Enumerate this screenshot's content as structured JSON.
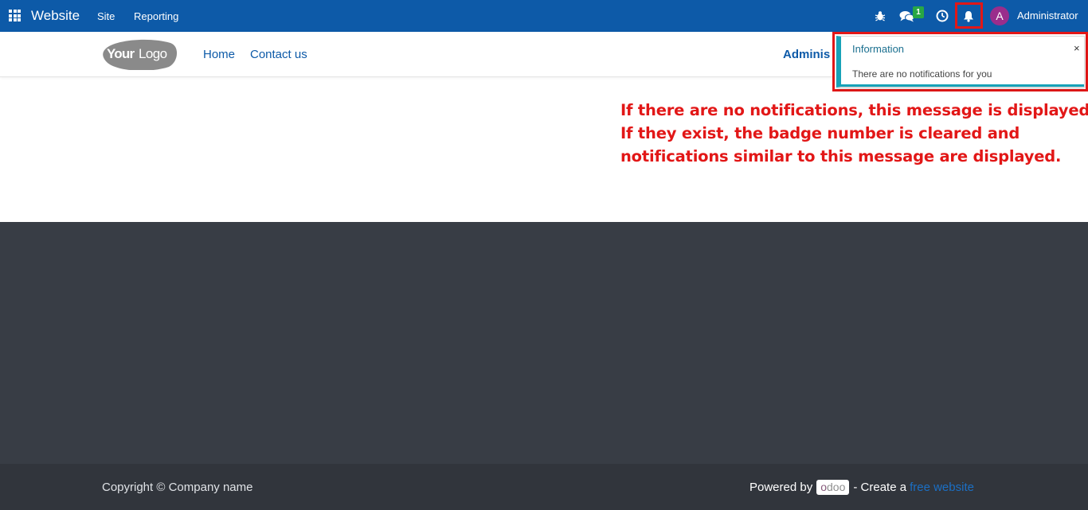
{
  "topbar": {
    "app_name": "Website",
    "menu": [
      "Site",
      "Reporting"
    ],
    "icons": [
      "apps-grid-icon",
      "bug-icon",
      "chat-icon",
      "clock-icon",
      "bell-icon"
    ],
    "chat_badge": "1",
    "avatar_initial": "A",
    "user_name": "Administrator",
    "background_color": "#0d5aa8"
  },
  "header": {
    "logo_text_bold": "Your",
    "logo_text_light": "Logo",
    "nav": [
      "Home",
      "Contact us"
    ],
    "user_label": "Adminis"
  },
  "notification": {
    "title": "Information",
    "close": "×",
    "message": "There are no notifications for you",
    "accent_color": "#17a2b8"
  },
  "annotation": {
    "lines": [
      "If there are no notifications, this message is displayed.",
      "If they exist, the badge number is cleared and",
      "notifications similar to this message are displayed."
    ],
    "color": "#e21717"
  },
  "footer": {
    "copyright": "Copyright © Company name",
    "powered_by": "Powered by",
    "odoo_o": "o",
    "odoo_rest": "doo",
    "create_text": "- Create a",
    "free_link": "free website",
    "background_color": "#383d45"
  }
}
